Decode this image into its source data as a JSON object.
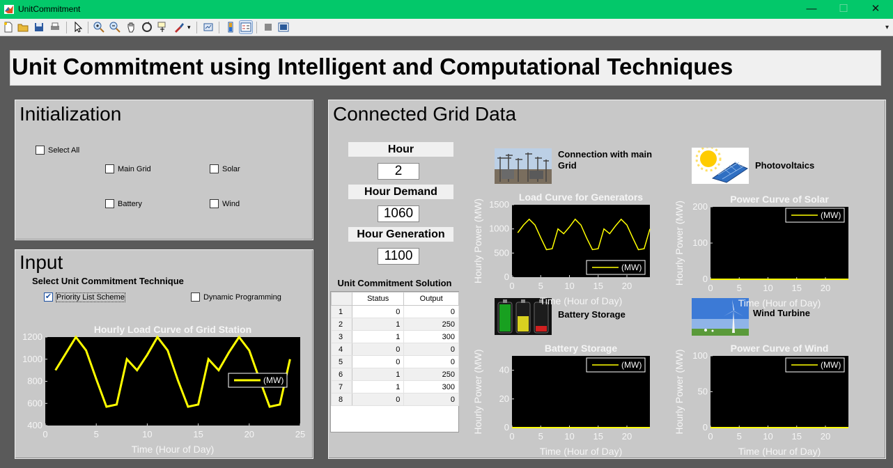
{
  "window": {
    "title": "UnitCommitment",
    "minimize": "—",
    "maximize": "☐",
    "close": "✕"
  },
  "toolbar": {
    "icons": [
      "new-file-icon",
      "open-folder-icon",
      "save-icon",
      "print-icon",
      "pointer-icon",
      "zoom-in-icon",
      "zoom-out-icon",
      "pan-hand-icon",
      "rotate-icon",
      "data-cursor-icon",
      "brush-icon",
      "link-plot-icon",
      "colorbar-icon",
      "legend-icon",
      "hide-plot-tools-icon",
      "show-plot-tools-icon"
    ],
    "overflow": "▾"
  },
  "header": {
    "title": "Unit Commitment using Intelligent and Computational Techniques"
  },
  "initialization": {
    "title": "Initialization",
    "select_all": "Select All",
    "main_grid": "Main Grid",
    "solar": "Solar",
    "battery": "Battery",
    "wind": "Wind"
  },
  "input": {
    "title": "Input",
    "technique_label": "Select Unit Commitment Technique",
    "priority_list": "Priority List Scheme",
    "priority_list_checked": true,
    "dynamic_programming": "Dynamic Programming",
    "dynamic_programming_checked": false
  },
  "grid": {
    "title": "Connected Grid Data",
    "hour_label": "Hour",
    "hour_value": "2",
    "demand_label": "Hour Demand",
    "demand_value": "1060",
    "generation_label": "Hour Generation",
    "generation_value": "1100",
    "table_title": "Unit Commitment Solution",
    "table_headers": [
      "Status",
      "Output"
    ],
    "table_rows": [
      [
        "1",
        "0",
        "0"
      ],
      [
        "2",
        "1",
        "250"
      ],
      [
        "3",
        "1",
        "300"
      ],
      [
        "4",
        "0",
        "0"
      ],
      [
        "5",
        "0",
        "0"
      ],
      [
        "6",
        "1",
        "250"
      ],
      [
        "7",
        "1",
        "300"
      ],
      [
        "8",
        "0",
        "0"
      ]
    ],
    "main_grid_caption": "Connection with main Grid",
    "pv_caption": "Photovoltaics",
    "battery_caption": "Battery Storage",
    "wind_caption": "Wind Turbine"
  },
  "colors": {
    "plot_bg": "#000000",
    "line": "#ffff00",
    "panel": "#c8c8c8"
  },
  "chart_data": [
    {
      "id": "hourly-load",
      "type": "line",
      "title": "Hourly Load Curve of Grid Station",
      "xlabel": "Time (Hour of Day)",
      "ylabel": "",
      "xlim": [
        0,
        25
      ],
      "ylim": [
        400,
        1200
      ],
      "xticks": [
        0,
        5,
        10,
        15,
        20,
        25
      ],
      "yticks": [
        400,
        600,
        800,
        1000,
        1200
      ],
      "legend": "top-right",
      "series": [
        {
          "name": "(MW)",
          "x": [
            1,
            2,
            3,
            4,
            5,
            6,
            7,
            8,
            9,
            10,
            11,
            12,
            13,
            14,
            15,
            16,
            17,
            18,
            19,
            20,
            21,
            22,
            23,
            24
          ],
          "values": [
            900,
            1050,
            1200,
            1080,
            820,
            570,
            590,
            1000,
            900,
            1040,
            1200,
            1080,
            810,
            570,
            590,
            1000,
            900,
            1060,
            1200,
            1080,
            820,
            570,
            590,
            1000
          ]
        }
      ]
    },
    {
      "id": "generators",
      "type": "line",
      "title": "Load Curve for Generators",
      "xlabel": "Time (Hour of Day)",
      "ylabel": "Hourly Power (MW)",
      "xlim": [
        0,
        24
      ],
      "ylim": [
        0,
        1500
      ],
      "xticks": [
        0,
        5,
        10,
        15,
        20
      ],
      "yticks": [
        0,
        500,
        1000,
        1500
      ],
      "legend": "bottom-right",
      "series": [
        {
          "name": "(MW)",
          "x": [
            1,
            2,
            3,
            4,
            5,
            6,
            7,
            8,
            9,
            10,
            11,
            12,
            13,
            14,
            15,
            16,
            17,
            18,
            19,
            20,
            21,
            22,
            23,
            24
          ],
          "values": [
            920,
            1080,
            1200,
            1080,
            820,
            570,
            590,
            1000,
            900,
            1040,
            1200,
            1080,
            810,
            570,
            590,
            1000,
            900,
            1060,
            1200,
            1080,
            820,
            570,
            590,
            1000
          ]
        }
      ]
    },
    {
      "id": "solar",
      "type": "line",
      "title": "Power Curve of Solar",
      "xlabel": "Time (Hour of Day)",
      "ylabel": "Hourly Power (MW)",
      "xlim": [
        0,
        24
      ],
      "ylim": [
        0,
        200
      ],
      "xticks": [
        0,
        5,
        10,
        15,
        20
      ],
      "yticks": [
        0,
        100,
        200
      ],
      "legend": "top-right",
      "series": [
        {
          "name": "(MW)",
          "x": [
            0,
            24
          ],
          "values": [
            0,
            0
          ]
        }
      ]
    },
    {
      "id": "battery",
      "type": "line",
      "title": "Battery Storage",
      "xlabel": "Time (Hour of Day)",
      "ylabel": "Hourly Power (MW)",
      "xlim": [
        0,
        24
      ],
      "ylim": [
        0,
        50
      ],
      "xticks": [
        0,
        5,
        10,
        15,
        20
      ],
      "yticks": [
        0,
        20,
        40
      ],
      "legend": "top-right",
      "series": [
        {
          "name": "(MW)",
          "x": [
            0,
            24
          ],
          "values": [
            0,
            0
          ]
        }
      ]
    },
    {
      "id": "wind",
      "type": "line",
      "title": "Power Curve of Wind",
      "xlabel": "Time (Hour of Day)",
      "ylabel": "Hourly Power (MW)",
      "xlim": [
        0,
        24
      ],
      "ylim": [
        0,
        100
      ],
      "xticks": [
        0,
        5,
        10,
        15,
        20
      ],
      "yticks": [
        0,
        50,
        100
      ],
      "legend": "top-right",
      "series": [
        {
          "name": "(MW)",
          "x": [
            0,
            24
          ],
          "values": [
            0,
            0
          ]
        }
      ]
    }
  ]
}
